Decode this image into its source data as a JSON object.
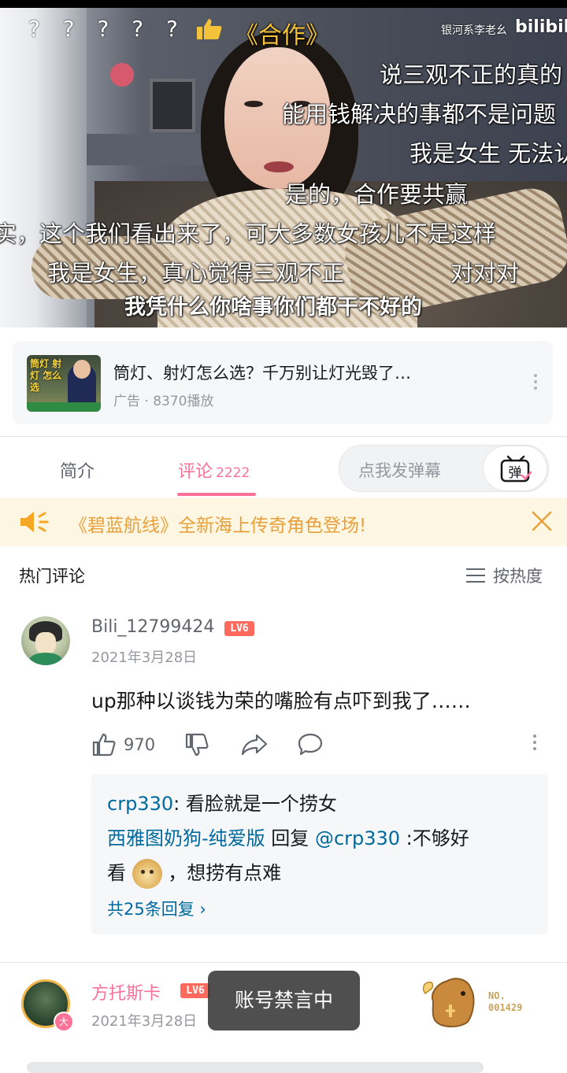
{
  "video": {
    "question_marks": "? ? ? ? ?",
    "danmaku": [
      {
        "text": "《合作》",
        "gold": true
      },
      {
        "text": "说三观不正的真的"
      },
      {
        "text": "能用钱解决的事都不是问题"
      },
      {
        "text": "我是女生 无法认"
      },
      {
        "text": "是的，合作要共赢"
      },
      {
        "text": "实，这个我们看出来了，可大多数女孩儿不是这样"
      },
      {
        "text": "我是女生，真心觉得三观不正"
      },
      {
        "text": "对对对"
      }
    ],
    "subtitle": "我凭什么你啥事你们都干不好的",
    "watermark_user": "银河系李老幺",
    "watermark_logo": "bilibili"
  },
  "ad": {
    "thumb_text": "筒灯 射灯 怎么选",
    "title": "筒灯、射灯怎么选？千万别让灯光毁了…",
    "meta": "广告 · 8370播放"
  },
  "tabs": {
    "intro": "简介",
    "comments": "评论",
    "comment_count": "2222",
    "danmaku_placeholder": "点我发弹幕",
    "danmaku_button": "弹"
  },
  "notice": {
    "text": "《碧蓝航线》全新海上传奇角色登场!"
  },
  "comments_header": {
    "title": "热门评论",
    "sort": "按热度"
  },
  "comments": [
    {
      "user": "Bili_12799424",
      "level": "LV6",
      "date": "2021年3月28日",
      "text": "up那种以谈钱为荣的嘴脸有点吓到我了……",
      "likes": "970",
      "replies": {
        "r1_user": "crp330",
        "r1_text": ": 看脸就是一个捞女",
        "r2_user": "西雅图奶狗-纯爱版",
        "r2_mid": " 回复 ",
        "r2_at": "@crp330",
        "r2_text1": " :不够好",
        "r2_text2_a": "看",
        "r2_text2_b": "，想捞有点难",
        "more": "共25条回复 ›"
      }
    },
    {
      "user": "方托斯卡",
      "level": "LV6",
      "date": "2021年3月28日",
      "badge": "大",
      "fan_no_label": "NO.",
      "fan_no": "001429"
    }
  ],
  "toast": "账号禁言中",
  "colors": {
    "brand_pink": "#fb7299",
    "link_blue": "#00699d",
    "notice_orange": "#e8a03a",
    "level_red": "#ff6a5d"
  }
}
